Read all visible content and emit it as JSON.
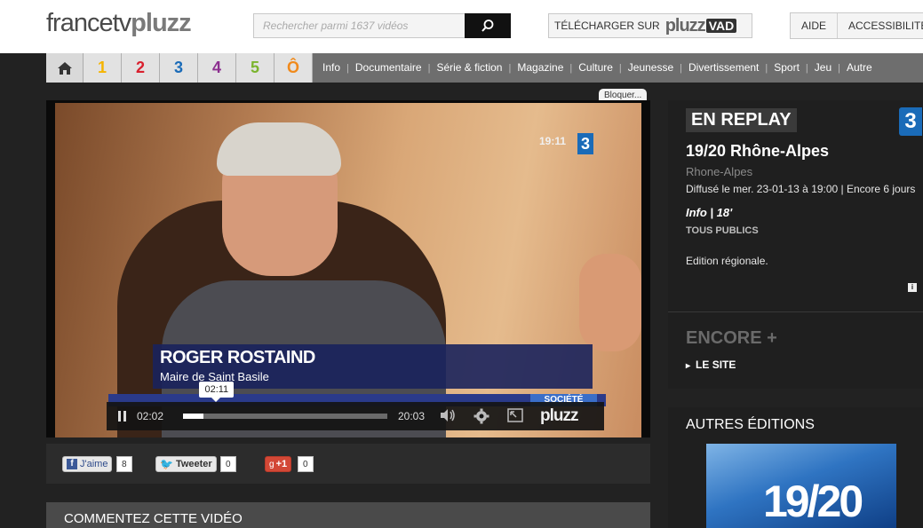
{
  "header": {
    "logo_part1": "francetv",
    "logo_part2": "pluzz",
    "search_placeholder": "Rechercher parmi 1637 vidéos",
    "vad_prefix": "TÉLÉCHARGER SUR",
    "vad_brand": "pluzz",
    "vad_badge": "VAD",
    "links": [
      "AIDE",
      "ACCESSIBILITÉ"
    ]
  },
  "nav": {
    "channels": [
      "1",
      "2",
      "3",
      "4",
      "5",
      "Ô"
    ],
    "channel_colors": [
      "#f5b400",
      "#d9202e",
      "#1a6bb8",
      "#8c2f8f",
      "#7bb42e",
      "#f08a1c"
    ],
    "links": [
      "Info",
      "Documentaire",
      "Série & fiction",
      "Magazine",
      "Culture",
      "Jeunesse",
      "Divertissement",
      "Sport",
      "Jeu",
      "Autre"
    ]
  },
  "player": {
    "bloquer": "Bloquer...",
    "on_screen_time": "19:11",
    "lower_third_name": "ROGER ROSTAIND",
    "lower_third_role": "Maire de Saint Basile",
    "ticker_label": "SOCIÉTÉ",
    "current_time": "02:02",
    "hover_time": "02:11",
    "duration": "20:03",
    "progress_fraction": 0.102,
    "brand": "pluzz"
  },
  "social": {
    "like_label": "J'aime",
    "like_count": "8",
    "tweet_label": "Tweeter",
    "tweet_count": "0",
    "gplus_label": "+1",
    "gplus_count": "0"
  },
  "comments_title": "COMMENTEZ CETTE VIDÉO",
  "panel": {
    "badge": "EN REPLAY",
    "channel_logo": "3",
    "title": "19/20 Rhône-Alpes",
    "subtitle": "Rhone-Alpes",
    "broadcast": "Diffusé le mer. 23-01-13 à 19:00 | Encore 6 jours",
    "meta": "Info | 18'",
    "audience": "TOUS PUBLICS",
    "description": "Edition régionale.",
    "encore": "ENCORE +",
    "site_link": "LE SITE"
  },
  "other_editions": {
    "title": "AUTRES ÉDITIONS",
    "thumb_text": "19/20"
  }
}
